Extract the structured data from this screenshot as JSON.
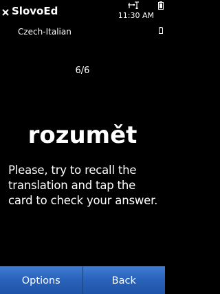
{
  "header": {
    "app_title": "SlovoEd",
    "dictionary": "Czech-Italian",
    "time": "11:30 AM"
  },
  "card": {
    "counter": "6/6",
    "word": "rozumět",
    "instruction": "Please, try to recall the translation and tap the card to check your answer."
  },
  "softkeys": {
    "left_label": "Options",
    "right_label": "Back"
  },
  "icons": {
    "close": "close-icon",
    "usb": "usb-icon",
    "signal": "signal-icon",
    "battery": "battery-icon"
  },
  "colors": {
    "background": "#000000",
    "softkey": "#2a63bb",
    "text": "#ffffff"
  }
}
